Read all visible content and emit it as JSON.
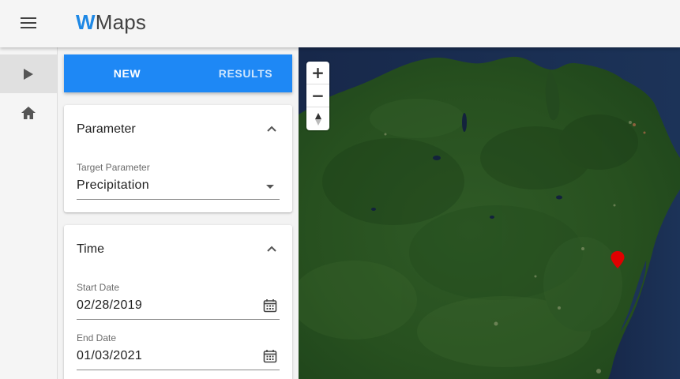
{
  "app": {
    "logo_w": "W",
    "logo_rest": "Maps",
    "menu_icon": "hamburger-menu-icon"
  },
  "rail": {
    "items": [
      {
        "icon": "play-icon",
        "active": true
      },
      {
        "icon": "home-icon",
        "active": false
      }
    ]
  },
  "tabs": {
    "new_label": "NEW",
    "results_label": "RESULTS",
    "accent": "#1e88f5"
  },
  "parameter_card": {
    "title": "Parameter",
    "field_label": "Target Parameter",
    "field_value": "Precipitation"
  },
  "time_card": {
    "title": "Time",
    "start_label": "Start Date",
    "start_value": "02/28/2019",
    "end_label": "End Date",
    "end_value": "01/03/2021"
  },
  "map": {
    "zoom_in_label": "+",
    "zoom_out_label": "−",
    "marker_color": "#e00000",
    "water_color": "#15284a",
    "land_color": "#254d22"
  }
}
